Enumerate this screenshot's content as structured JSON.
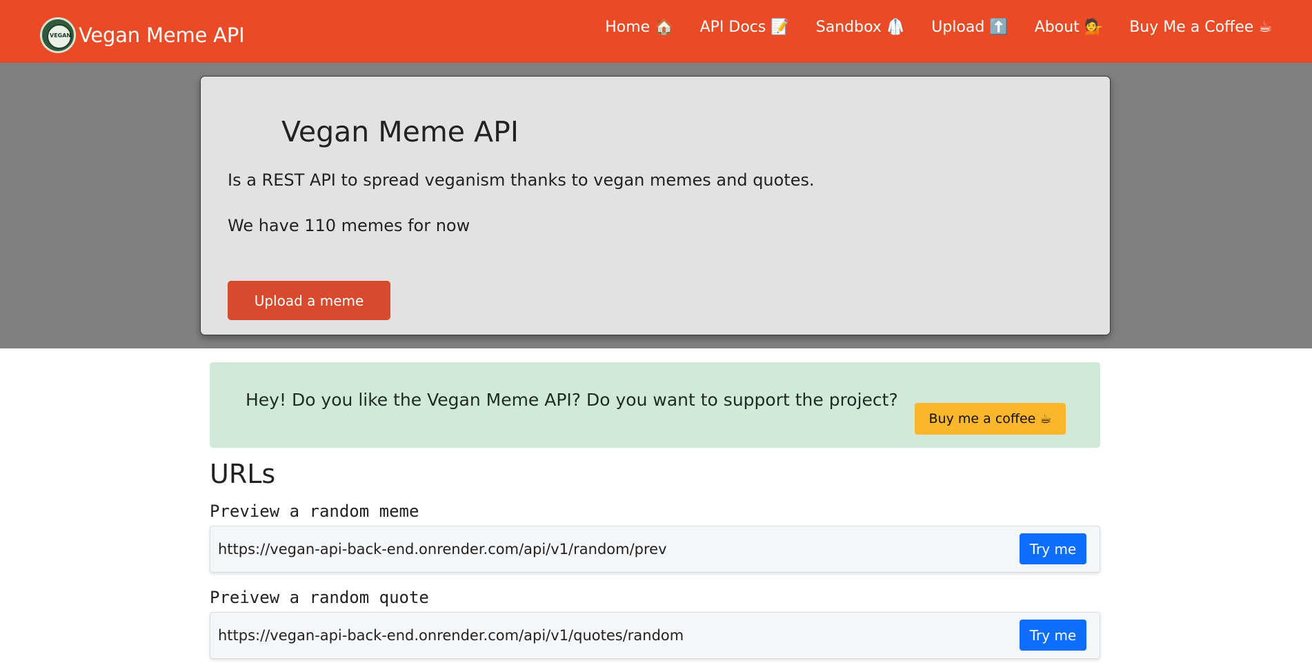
{
  "navbar": {
    "brand": "Vegan Meme API",
    "logo_text": "VEGAN",
    "links": [
      "Home 🏠",
      "API Docs 📝",
      "Sandbox 🥼",
      "Upload ⬆️",
      "About 💁",
      "Buy Me a Coffee ☕"
    ]
  },
  "hero": {
    "title": "Vegan Meme API",
    "description": "Is a REST API to spread veganism thanks to vegan memes and quotes.",
    "count_text": "We have 110 memes for now",
    "upload_label": "Upload a meme"
  },
  "support": {
    "text": "Hey! Do you like the Vegan Meme API? Do you want to support the project?",
    "button": "Buy me a coffee ☕"
  },
  "urls": {
    "title": "URLs",
    "items": [
      {
        "label": "Preview a random meme",
        "url": "https://vegan-api-back-end.onrender.com/api/v1/random/prev",
        "button": "Try me"
      },
      {
        "label": "Preivew a random quote",
        "url": "https://vegan-api-back-end.onrender.com/api/v1/quotes/random",
        "button": "Try me"
      }
    ]
  },
  "colors": {
    "navbar": "#ea4b26",
    "hero_band": "#808080",
    "upload_button": "#d84a2d",
    "alert_bg": "#d1e9d7",
    "coffee_button": "#fbb72b",
    "try_button": "#0d6efd"
  }
}
